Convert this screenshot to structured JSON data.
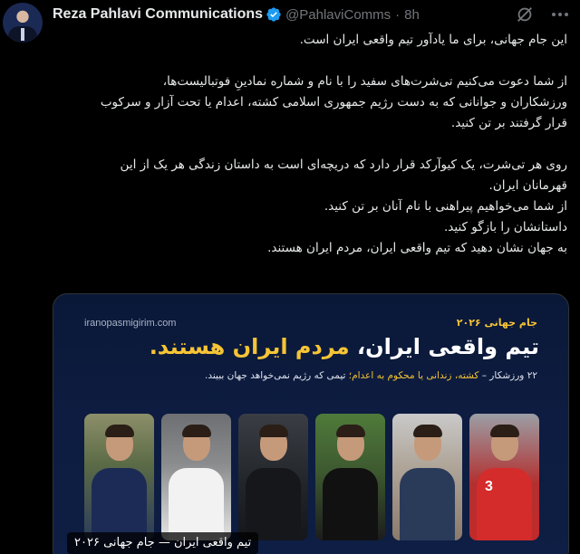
{
  "author": {
    "name": "Reza Pahlavi Communications",
    "handle": "@PahlaviComms",
    "separator": "·",
    "time": "8h"
  },
  "icons": {
    "verified": "verified-badge-icon",
    "grok": "grok-icon",
    "more": "more-options-icon"
  },
  "colors": {
    "verified": "#1d9bf0",
    "accent_yellow": "#f6c435",
    "background": "#000000",
    "text": "#e7e9ea",
    "muted": "#71767b"
  },
  "tweet": {
    "lines": [
      "این جام جهانی، برای ما یادآور تیم واقعی ایران است.",
      "",
      "از شما دعوت می‌کنیم تی‌شرت‌های سفید را با نام و شماره نمادینِ فوتبالیست‌ها،",
      "ورزشکاران و جوانانی که به دست رژیم جمهوری اسلامی کشته، اعدام یا تحت آزار و سرکوب",
      "قرار گرفتند بر تن کنید.",
      "",
      "روی هر تی‌شرت، یک کیوآرکد قرار دارد که دریچه‌ای است به داستان زندگی هر یک از این",
      "قهرمانان ایران.",
      "از شما می‌خواهیم پیراهنی با نام آنان بر تن کنید.",
      "داستانشان را بازگو کنید.",
      "به جهان نشان دهید که تیم واقعی ایران، مردم ایران هستند."
    ]
  },
  "media": {
    "site": "iranopasmigirim.com",
    "badge": "جام جهانی ۲۰۲۶",
    "headline_main": "تیم واقعی ایران، ",
    "headline_accent": "مردم ایران هستند.",
    "sub_prefix": "۲۲ ورزشکار – ",
    "sub_accent": "کشته، زندانی یا محکوم به اعدام؛",
    "sub_suffix": " تیمی که رژیم نمی‌خواهد جهان ببیند.",
    "photos": [
      {
        "name": "athlete-photo-1"
      },
      {
        "name": "athlete-photo-2"
      },
      {
        "name": "athlete-photo-3"
      },
      {
        "name": "athlete-photo-4"
      },
      {
        "name": "athlete-photo-5"
      },
      {
        "name": "athlete-photo-6",
        "number": "3"
      }
    ],
    "caption": "تیم واقعی ایران — جام جهانی ۲۰۲۶"
  }
}
